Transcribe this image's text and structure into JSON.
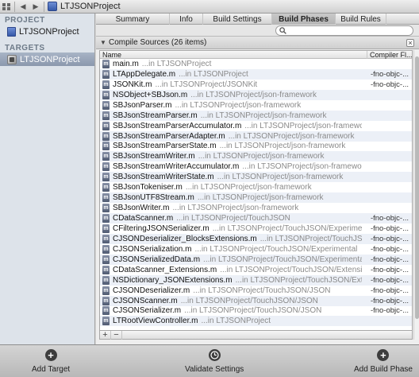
{
  "jumpbar": {
    "title": "LTJSONProject"
  },
  "sidebar": {
    "project_header": "PROJECT",
    "project_item": "LTJSONProject",
    "targets_header": "TARGETS",
    "target_item": "LTJSONProject"
  },
  "tabs": [
    "Summary",
    "Info",
    "Build Settings",
    "Build Phases",
    "Build Rules"
  ],
  "active_tab": "Build Phases",
  "search": {
    "value": "",
    "placeholder": ""
  },
  "phase": {
    "title": "Compile Sources (26 items)",
    "columns": {
      "name": "Name",
      "flags": "Compiler Fl..."
    }
  },
  "files": [
    {
      "name": "main.m",
      "path": "...in LTJSONProject",
      "flags": ""
    },
    {
      "name": "LTAppDelegate.m",
      "path": "...in LTJSONProject",
      "flags": "-fno-objc-..."
    },
    {
      "name": "JSONKit.m",
      "path": "...in LTJSONProject/JSONKit",
      "flags": "-fno-objc-..."
    },
    {
      "name": "NSObject+SBJson.m",
      "path": "...in LTJSONProject/json-framework",
      "flags": ""
    },
    {
      "name": "SBJsonParser.m",
      "path": "...in LTJSONProject/json-framework",
      "flags": ""
    },
    {
      "name": "SBJsonStreamParser.m",
      "path": "...in LTJSONProject/json-framework",
      "flags": ""
    },
    {
      "name": "SBJsonStreamParserAccumulator.m",
      "path": "...in LTJSONProject/json-framework",
      "flags": ""
    },
    {
      "name": "SBJsonStreamParserAdapter.m",
      "path": "...in LTJSONProject/json-framework",
      "flags": ""
    },
    {
      "name": "SBJsonStreamParserState.m",
      "path": "...in LTJSONProject/json-framework",
      "flags": ""
    },
    {
      "name": "SBJsonStreamWriter.m",
      "path": "...in LTJSONProject/json-framework",
      "flags": ""
    },
    {
      "name": "SBJsonStreamWriterAccumulator.m",
      "path": "...in LTJSONProject/json-framework",
      "flags": ""
    },
    {
      "name": "SBJsonStreamWriterState.m",
      "path": "...in LTJSONProject/json-framework",
      "flags": ""
    },
    {
      "name": "SBJsonTokeniser.m",
      "path": "...in LTJSONProject/json-framework",
      "flags": ""
    },
    {
      "name": "SBJsonUTF8Stream.m",
      "path": "...in LTJSONProject/json-framework",
      "flags": ""
    },
    {
      "name": "SBJsonWriter.m",
      "path": "...in LTJSONProject/json-framework",
      "flags": ""
    },
    {
      "name": "CDataScanner.m",
      "path": "...in LTJSONProject/TouchJSON",
      "flags": "-fno-objc-..."
    },
    {
      "name": "CFilteringJSONSerializer.m",
      "path": "...in LTJSONProject/TouchJSON/Experimental",
      "flags": "-fno-objc-..."
    },
    {
      "name": "CJSONDeserializer_BlocksExtensions.m",
      "path": "...in LTJSONProject/TouchJSON/Experimental",
      "flags": "-fno-objc-..."
    },
    {
      "name": "CJSONSerialization.m",
      "path": "...in LTJSONProject/TouchJSON/Experimental",
      "flags": "-fno-objc-..."
    },
    {
      "name": "CJSONSerializedData.m",
      "path": "...in LTJSONProject/TouchJSON/Experimental",
      "flags": "-fno-objc-..."
    },
    {
      "name": "CDataScanner_Extensions.m",
      "path": "...in LTJSONProject/TouchJSON/Extensions",
      "flags": "-fno-objc-..."
    },
    {
      "name": "NSDictionary_JSONExtensions.m",
      "path": "...in LTJSONProject/TouchJSON/Extensions",
      "flags": "-fno-objc-..."
    },
    {
      "name": "CJSONDeserializer.m",
      "path": "...in LTJSONProject/TouchJSON/JSON",
      "flags": "-fno-objc-..."
    },
    {
      "name": "CJSONScanner.m",
      "path": "...in LTJSONProject/TouchJSON/JSON",
      "flags": "-fno-objc-..."
    },
    {
      "name": "CJSONSerializer.m",
      "path": "...in LTJSONProject/TouchJSON/JSON",
      "flags": "-fno-objc-..."
    },
    {
      "name": "LTRootViewController.m",
      "path": "...in LTJSONProject",
      "flags": ""
    }
  ],
  "table_footer": {
    "add": "+",
    "remove": "−"
  },
  "bottombar": {
    "add_target": "Add Target",
    "validate_settings": "Validate Settings",
    "add_build_phase": "Add Build Phase"
  }
}
